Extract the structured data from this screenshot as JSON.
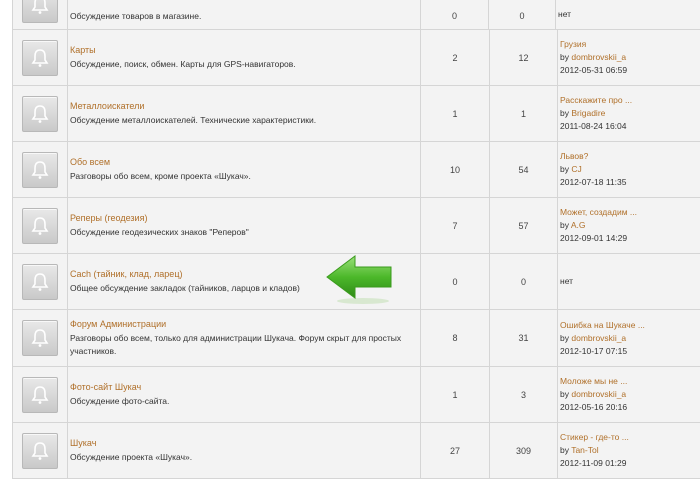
{
  "by_label": "by",
  "colors": {
    "link": "#b0702a",
    "text": "#333333",
    "row_bg": "#f3f3f3",
    "border": "#d5d5d5",
    "arrow": "#4caf2a"
  },
  "rows": [
    {
      "title": "",
      "desc": "Обсуждение товаров в магазине.",
      "topics": "0",
      "posts": "0",
      "last_none": "нет",
      "height": 50
    },
    {
      "title": "Карты",
      "desc": "Обсуждение, поиск, обмен. Карты для GPS-навигаторов.",
      "topics": "2",
      "posts": "12",
      "last_title": "Грузия",
      "last_user": "dombrovskii_a",
      "last_date": "2012-05-31 06:59"
    },
    {
      "title": "Металлоискатели",
      "desc": "Обсуждение металлоискателей. Технические характеристики.",
      "topics": "1",
      "posts": "1",
      "last_title": "Расскажите про ...",
      "last_user": "Brigadire",
      "last_date": "2011-08-24 16:04"
    },
    {
      "title": "Обо всем",
      "desc": "Разговоры обо всем, кроме проекта «Шукач».",
      "topics": "10",
      "posts": "54",
      "last_title": "Львов?",
      "last_user": "CJ",
      "last_date": "2012-07-18 11:35"
    },
    {
      "title": "Реперы (геодезия)",
      "desc": "Обсуждение геодезических знаков \"Реперов\"",
      "topics": "7",
      "posts": "57",
      "last_title": "Может, создадим ...",
      "last_user": "A.G",
      "last_date": "2012-09-01 14:29"
    },
    {
      "title": "Cach (тайник, клад, ларец)",
      "desc": "Общее обсуждение закладок (тайников, ларцов и кладов)",
      "topics": "0",
      "posts": "0",
      "last_none": "нет"
    },
    {
      "title": "Форум Администрации",
      "desc": "Разговоры обо всем, только для администрации Шукача. Форум скрыт для простых участников.",
      "topics": "8",
      "posts": "31",
      "last_title": "Ошибка на Шукаче ...",
      "last_user": "dombrovskii_a",
      "last_date": "2012-10-17 07:15"
    },
    {
      "title": "Фото-сайт Шукач",
      "desc": "Обсуждение фото-сайта.",
      "topics": "1",
      "posts": "3",
      "last_title": "Моложе мы не ...",
      "last_user": "dombrovskii_a",
      "last_date": "2012-05-16 20:16"
    },
    {
      "title": "Шукач",
      "desc": "Обсуждение проекта «Шукач».",
      "topics": "27",
      "posts": "309",
      "last_title": "Стикер - где-то ...",
      "last_user": "Tan-Tol",
      "last_date": "2012-11-09 01:29"
    }
  ]
}
